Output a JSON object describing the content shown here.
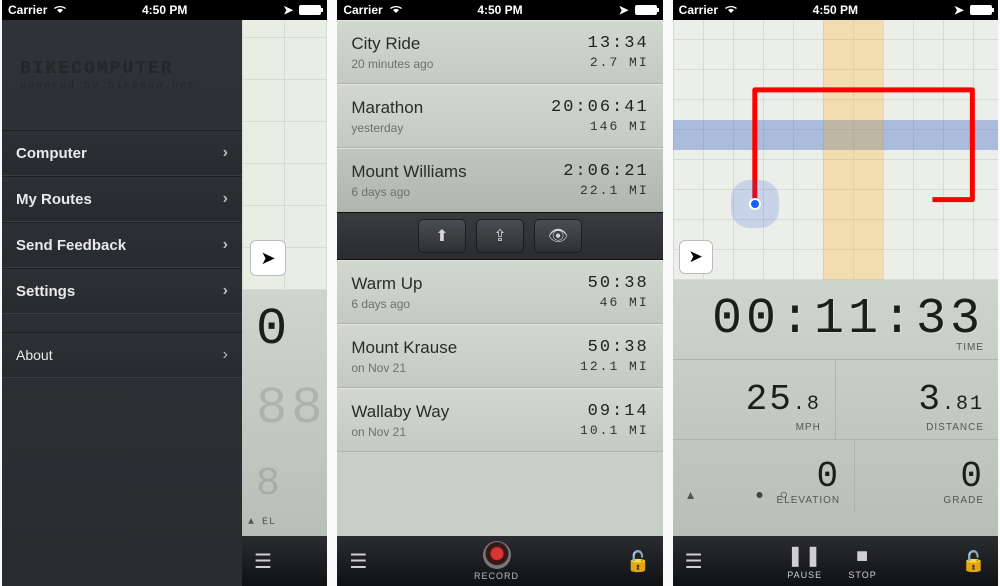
{
  "statusBar": {
    "carrier": "Carrier",
    "time": "4:50 PM"
  },
  "phone1": {
    "brand": {
      "title": "BIKECOMPUTER",
      "sub": "powered by bikemap.net"
    },
    "menu": [
      {
        "label": "Computer"
      },
      {
        "label": "My Routes"
      },
      {
        "label": "Send Feedback"
      },
      {
        "label": "Settings"
      }
    ],
    "menuSecondary": [
      {
        "label": "About"
      }
    ],
    "peek": {
      "timerFragment": "0",
      "elevFragment": "EL"
    }
  },
  "phone2": {
    "routes": [
      {
        "name": "City Ride",
        "meta": "20 minutes ago",
        "time": "13:34",
        "dist": "2.7 MI"
      },
      {
        "name": "Marathon",
        "meta": "yesterday",
        "time": "20:06:41",
        "dist": "146 MI"
      },
      {
        "name": "Mount Williams",
        "meta": "6 days ago",
        "time": "2:06:21",
        "dist": "22.1 MI",
        "selected": true
      },
      {
        "name": "Warm Up",
        "meta": "6 days ago",
        "time": "50:38",
        "dist": "46 MI"
      },
      {
        "name": "Mount Krause",
        "meta": "on Nov 21",
        "time": "50:38",
        "dist": "12.1 MI"
      },
      {
        "name": "Wallaby Way",
        "meta": "on Nov 21",
        "time": "09:14",
        "dist": "10.1 MI"
      }
    ],
    "recordLabel": "RECORD"
  },
  "phone3": {
    "timer": {
      "value": "00:11:33",
      "label": "TIME"
    },
    "speed": {
      "value": "25",
      "frac": ".8",
      "label": "MPH"
    },
    "distance": {
      "value": "3",
      "frac": ".81",
      "label": "DISTANCE"
    },
    "elevation": {
      "value": "0",
      "label": "ELEVATION"
    },
    "grade": {
      "value": "0",
      "label": "GRADE"
    },
    "controls": {
      "pause": "PAUSE",
      "stop": "STOP"
    }
  }
}
